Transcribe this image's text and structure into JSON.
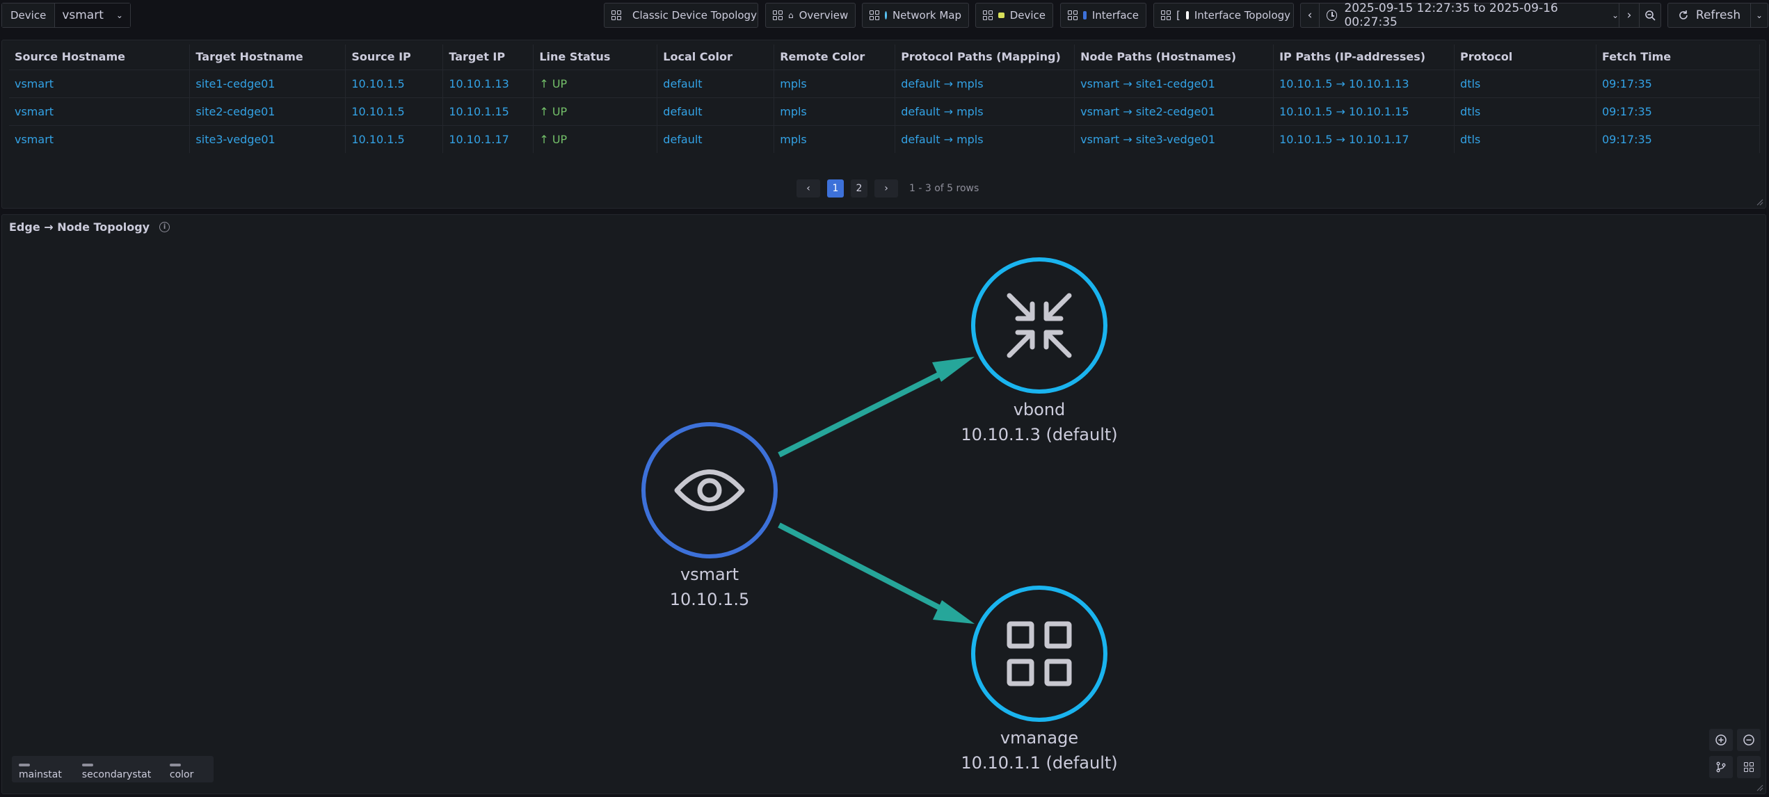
{
  "variable": {
    "label": "Device",
    "value": "vsmart"
  },
  "links": [
    {
      "label": "Classic Device Topology",
      "badge_color": "#3d71d9"
    },
    {
      "label": "Overview",
      "badge_color": "#ffffff"
    },
    {
      "label": "Network Map",
      "badge_color": "#5ac8fa"
    },
    {
      "label": "Device",
      "badge_color": "#d8e05a"
    },
    {
      "label": "Interface",
      "badge_color": "#3d71d9"
    },
    {
      "label": "Interface Topology",
      "prefix": "[",
      "badge_color": "#3d71d9"
    }
  ],
  "time_range": {
    "label": "2025-09-15 12:27:35 to 2025-09-16 00:27:35"
  },
  "refresh": {
    "label": "Refresh"
  },
  "table": {
    "columns": [
      "Source Hostname",
      "Target Hostname",
      "Source IP",
      "Target IP",
      "Line Status",
      "Local Color",
      "Remote Color",
      "Protocol Paths (Mapping)",
      "Node Paths (Hostnames)",
      "IP Paths (IP-addresses)",
      "Protocol",
      "Fetch Time"
    ],
    "rows": [
      [
        "vsmart",
        "site1-cedge01",
        "10.10.1.5",
        "10.10.1.13",
        "↑ UP",
        "default",
        "mpls",
        "default → mpls",
        "vsmart → site1-cedge01",
        "10.10.1.5 → 10.10.1.13",
        "dtls",
        "09:17:35"
      ],
      [
        "vsmart",
        "site2-cedge01",
        "10.10.1.5",
        "10.10.1.15",
        "↑ UP",
        "default",
        "mpls",
        "default → mpls",
        "vsmart → site2-cedge01",
        "10.10.1.5 → 10.10.1.15",
        "dtls",
        "09:17:35"
      ],
      [
        "vsmart",
        "site3-vedge01",
        "10.10.1.5",
        "10.10.1.17",
        "↑ UP",
        "default",
        "mpls",
        "default → mpls",
        "vsmart → site3-vedge01",
        "10.10.1.5 → 10.10.1.17",
        "dtls",
        "09:17:35"
      ]
    ],
    "pagination": {
      "prev": "‹",
      "pages": [
        "1",
        "2"
      ],
      "current": "1",
      "next": "›",
      "summary": "1 - 3 of 5 rows"
    }
  },
  "topology": {
    "title": "Edge → Node Topology",
    "nodes": [
      {
        "id": "vsmart",
        "name": "vsmart",
        "stat": "10.10.1.5",
        "icon": "eye-icon",
        "color": "#3d71d9"
      },
      {
        "id": "vbond",
        "name": "vbond",
        "stat": "10.10.1.3 (default)",
        "icon": "compress-icon",
        "color": "#1ab4ef"
      },
      {
        "id": "vmanage",
        "name": "vmanage",
        "stat": "10.10.1.1 (default)",
        "icon": "apps-grid-icon",
        "color": "#1ab4ef"
      }
    ],
    "edge_color": "#26a69a",
    "legend": [
      "mainstat",
      "secondarystat",
      "color"
    ]
  }
}
